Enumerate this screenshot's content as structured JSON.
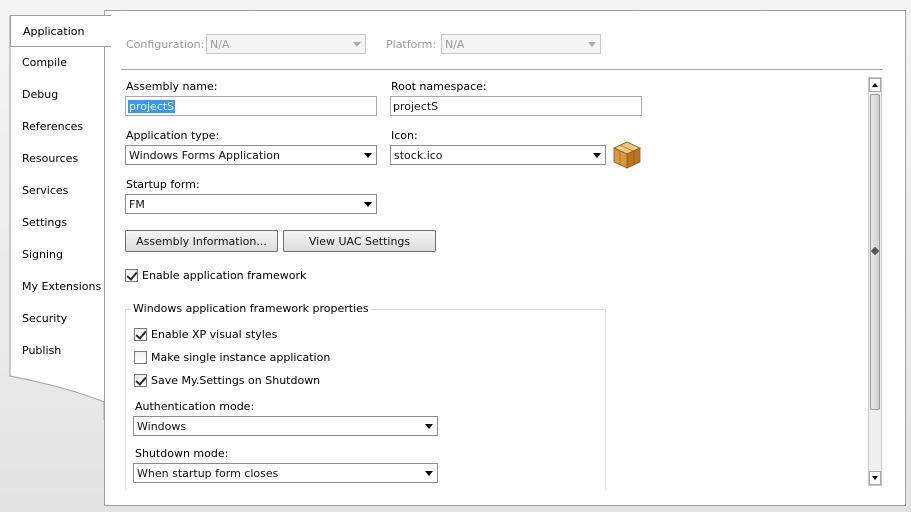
{
  "sidebar": {
    "items": [
      {
        "label": "Application",
        "active": true
      },
      {
        "label": "Compile"
      },
      {
        "label": "Debug"
      },
      {
        "label": "References"
      },
      {
        "label": "Resources"
      },
      {
        "label": "Services"
      },
      {
        "label": "Settings"
      },
      {
        "label": "Signing"
      },
      {
        "label": "My Extensions"
      },
      {
        "label": "Security"
      },
      {
        "label": "Publish"
      }
    ]
  },
  "toolbar": {
    "configuration_label": "Configuration:",
    "configuration_value": "N/A",
    "platform_label": "Platform:",
    "platform_value": "N/A"
  },
  "form": {
    "assembly_name_label": "Assembly name:",
    "assembly_name_value": "projectS",
    "root_namespace_label": "Root namespace:",
    "root_namespace_value": "projectS",
    "application_type_label": "Application type:",
    "application_type_value": "Windows Forms Application",
    "icon_label": "Icon:",
    "icon_value": "stock.ico",
    "startup_form_label": "Startup form:",
    "startup_form_value": "FM",
    "assembly_info_button": "Assembly Information...",
    "uac_button": "View UAC Settings",
    "enable_framework_label": "Enable application framework",
    "enable_framework_checked": true
  },
  "framework_group": {
    "title": "Windows application framework properties",
    "xp_styles_label": "Enable XP visual styles",
    "xp_styles_checked": true,
    "single_instance_label": "Make single instance application",
    "single_instance_checked": false,
    "save_settings_label": "Save My.Settings on Shutdown",
    "save_settings_checked": true,
    "auth_mode_label": "Authentication mode:",
    "auth_mode_value": "Windows",
    "shutdown_mode_label": "Shutdown mode:",
    "shutdown_mode_value": "When startup form closes"
  },
  "colors": {
    "selection": "#3399ff",
    "panel_border": "#a0a0a0",
    "disabled_text": "#9a9a9a"
  },
  "icons": {
    "app_icon": "package-box-icon",
    "dropdown": "chevron-down-icon"
  }
}
